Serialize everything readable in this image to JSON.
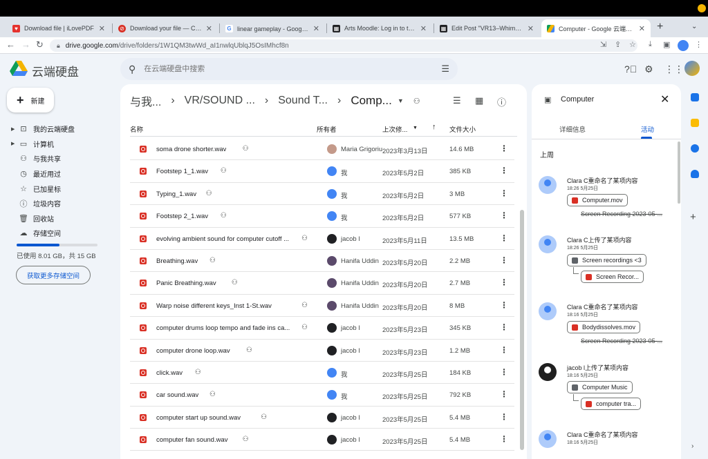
{
  "browser": {
    "tabs": [
      {
        "title": "Download file | iLovePDF",
        "color": "#e5322d"
      },
      {
        "title": "Download your file — Conver",
        "color": "#d93025"
      },
      {
        "title": "linear gameplay - Google 搜索",
        "color": "#4285f4"
      },
      {
        "title": "Arts Moodle: Log in to the site",
        "color": "#202124"
      },
      {
        "title": "Edit Post \"VR13–Whimsies A",
        "color": "#202124"
      },
      {
        "title": "Computer - Google 云端硬盘",
        "color": "#1a73e8"
      }
    ],
    "new_tab": "+",
    "url_host": "drive.google.com",
    "url_path": "/drive/folders/1W1QM3twWd_aI1nwlqUblqJ5OsIMhcf8n"
  },
  "app": {
    "brand": "云端硬盘",
    "search_placeholder": "在云端硬盘中搜索",
    "new_button": "新建"
  },
  "sidebar": {
    "items": [
      {
        "label": "我的云端硬盘",
        "icon": "drive-icon",
        "caret": "▶"
      },
      {
        "label": "计算机",
        "icon": "computer-icon",
        "caret": "▶"
      },
      {
        "label": "与我共享",
        "icon": "shared-icon",
        "caret": ""
      },
      {
        "label": "最近用过",
        "icon": "clock-icon",
        "caret": ""
      },
      {
        "label": "已加星标",
        "icon": "star-icon",
        "caret": ""
      },
      {
        "label": "垃圾内容",
        "icon": "spam-icon",
        "caret": ""
      },
      {
        "label": "回收站",
        "icon": "trash-icon",
        "caret": ""
      },
      {
        "label": "存储空间",
        "icon": "cloud-icon",
        "caret": ""
      }
    ],
    "storage_used_fraction": 0.534,
    "storage_text": "已使用 8.01 GB，共 15 GB",
    "get_more": "获取更多存储空间"
  },
  "breadcrumb": {
    "items": [
      "与我...",
      "VR/SOUND ...",
      "Sound T..."
    ],
    "current": "Comp..."
  },
  "table": {
    "headers": {
      "name": "名称",
      "owner": "所有者",
      "modified": "上次修...",
      "size": "文件大小"
    },
    "rows": [
      {
        "name": "soma drone shorter.wav",
        "owner": "Maria Grigoriu",
        "date": "2023年3月13日",
        "size": "14.6 MB",
        "avatar": "#c49a8a"
      },
      {
        "name": "Footstep 1_1.wav",
        "owner": "我",
        "date": "2023年5月2日",
        "size": "385 KB",
        "avatar": "#4285f4"
      },
      {
        "name": "Typing_1.wav",
        "owner": "我",
        "date": "2023年5月2日",
        "size": "3 MB",
        "avatar": "#4285f4"
      },
      {
        "name": "Footstep 2_1.wav",
        "owner": "我",
        "date": "2023年5月2日",
        "size": "577 KB",
        "avatar": "#4285f4"
      },
      {
        "name": "evolving ambient sound for computer cutoff ...",
        "owner": "jacob l",
        "date": "2023年5月11日",
        "size": "13.5 MB",
        "avatar": "#202124"
      },
      {
        "name": "Breathing.wav",
        "owner": "Hanifa Uddin",
        "date": "2023年5月20日",
        "size": "2.2 MB",
        "avatar": "#5b4a6b"
      },
      {
        "name": "Panic Breathing.wav",
        "owner": "Hanifa Uddin",
        "date": "2023年5月20日",
        "size": "2.7 MB",
        "avatar": "#5b4a6b"
      },
      {
        "name": "Warp noise different keys_Inst 1-St.wav",
        "owner": "Hanifa Uddin",
        "date": "2023年5月20日",
        "size": "8 MB",
        "avatar": "#5b4a6b"
      },
      {
        "name": "computer drums loop tempo and fade ins ca...",
        "owner": "jacob l",
        "date": "2023年5月23日",
        "size": "345 KB",
        "avatar": "#202124"
      },
      {
        "name": "computer drone loop.wav",
        "owner": "jacob l",
        "date": "2023年5月23日",
        "size": "1.2 MB",
        "avatar": "#202124"
      },
      {
        "name": "click.wav",
        "owner": "我",
        "date": "2023年5月25日",
        "size": "184 KB",
        "avatar": "#4285f4"
      },
      {
        "name": "car sound.wav",
        "owner": "我",
        "date": "2023年5月25日",
        "size": "792 KB",
        "avatar": "#4285f4"
      },
      {
        "name": "computer start up sound.wav",
        "owner": "jacob l",
        "date": "2023年5月25日",
        "size": "5.4 MB",
        "avatar": "#202124"
      },
      {
        "name": "computer fan sound.wav",
        "owner": "jacob l",
        "date": "2023年5月25日",
        "size": "5.4 MB",
        "avatar": "#202124"
      }
    ]
  },
  "details": {
    "title": "Computer",
    "tab_info": "详细信息",
    "tab_activity": "活动",
    "week_label": "上周",
    "activities": [
      {
        "who": "Clara C重命名了某项内容",
        "when": "18:26 5月25日",
        "chip": "Computer.mov",
        "strike": "Screen Recording 2023-05-..."
      },
      {
        "who": "Clara C上传了某项内容",
        "when": "18:26 5月25日",
        "folder": "Screen recordings <3",
        "child": "Screen Recor..."
      },
      {
        "who": "Clara C重命名了某项内容",
        "when": "18:16 5月25日",
        "chip": "Bodydissolves.mov",
        "strike": "Screen Recording 2023-05-..."
      },
      {
        "who": "jacob l上传了某项内容",
        "when": "18:16 5月25日",
        "folder": "Computer Music",
        "child": "computer tra..."
      },
      {
        "who": "Clara C重命名了某项内容",
        "when": "18:16 5月25日"
      }
    ]
  }
}
